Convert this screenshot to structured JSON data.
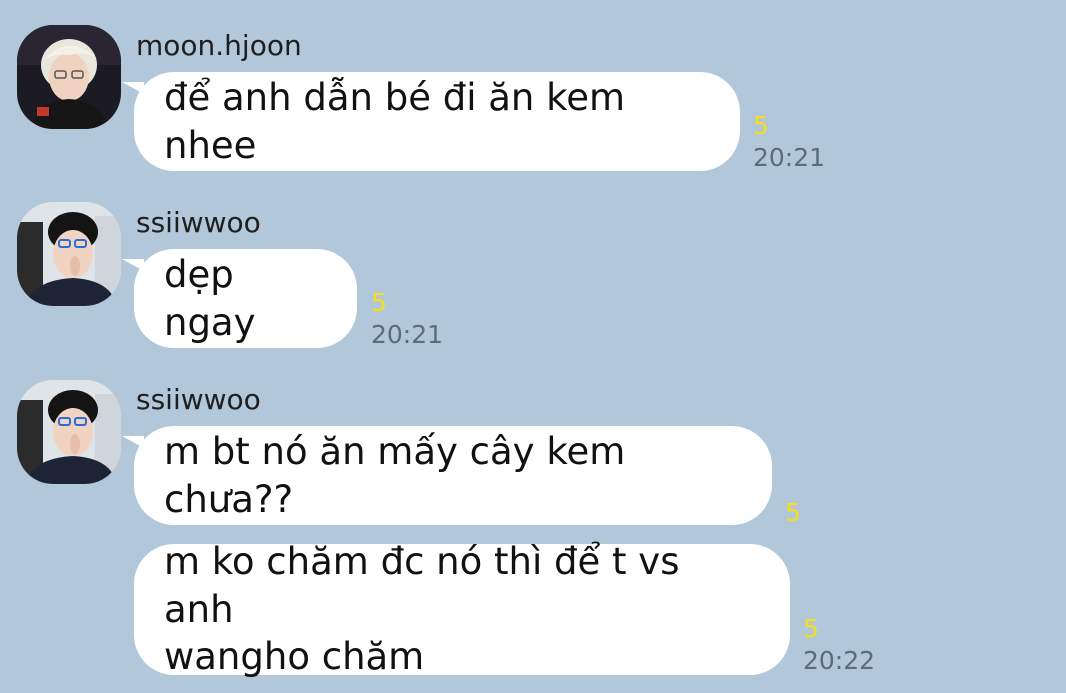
{
  "messages": [
    {
      "sender": "moon.hjoon",
      "text": "để anh dẫn bé đi ăn kem nhee",
      "unread": "5",
      "time": "20:21"
    },
    {
      "sender": "ssiiwwoo",
      "text": "dẹp ngay",
      "unread": "5",
      "time": "20:21"
    },
    {
      "sender": "ssiiwwoo",
      "text": "m bt nó ăn mấy cây kem chưa??",
      "unread": "5"
    },
    {
      "text_line1": "m ko chăm đc nó thì để t vs anh",
      "text_line2": "wangho chăm",
      "unread": "5",
      "time": "20:22"
    }
  ],
  "colors": {
    "background": "#b2c7da",
    "bubble": "#ffffff",
    "unread": "#f7dd1a",
    "time": "#5f6b77"
  },
  "icons": [
    "avatar-moon-hjoon",
    "avatar-ssiiwwoo"
  ]
}
